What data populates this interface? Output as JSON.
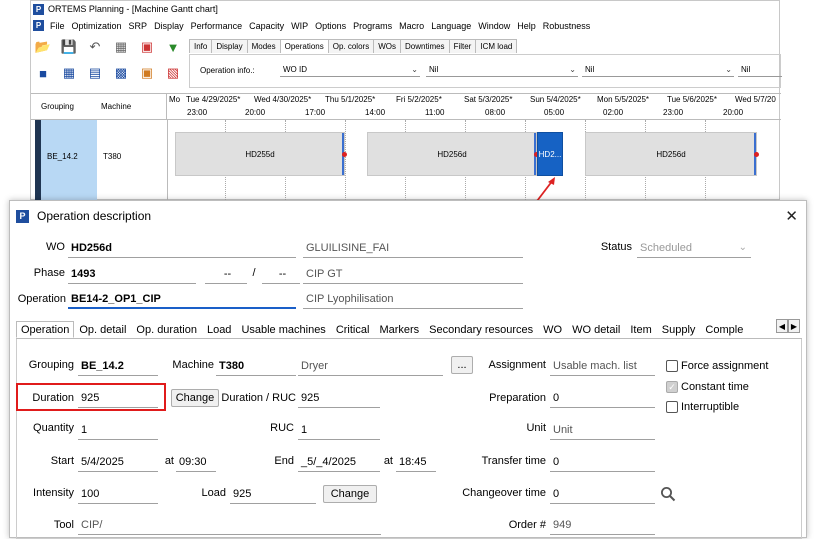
{
  "planning": {
    "title": "ORTEMS  Planning - [Machine Gantt chart]",
    "menu": [
      "File",
      "Optimization",
      "SRP",
      "Display",
      "Performance",
      "Capacity",
      "WIP",
      "Options",
      "Programs",
      "Macro",
      "Language",
      "Window",
      "Help",
      "Robustness"
    ],
    "tabs": [
      "Info",
      "Display",
      "Modes",
      "Operations",
      "Op. colors",
      "WOs",
      "Downtimes",
      "Filter",
      "ICM load"
    ],
    "opinfo_label": "Operation info.:",
    "opinfo_selects": [
      "WO ID",
      "Nil",
      "Nil",
      "Nil"
    ],
    "grid_headers": {
      "grouping": "Grouping",
      "machine": "Machine"
    },
    "days": [
      "Mo",
      "Tue 4/29/2025*",
      "Wed 4/30/2025*",
      "Thu 5/1/2025*",
      "Fri 5/2/2025*",
      "Sat 5/3/2025*",
      "Sun 5/4/2025*",
      "Mon 5/5/2025*",
      "Tue 5/6/2025*",
      "Wed 5/7/20"
    ],
    "hours": [
      "23:00",
      "20:00",
      "17:00",
      "14:00",
      "11:00",
      "08:00",
      "05:00",
      "02:00",
      "23:00",
      "20:00"
    ],
    "row": {
      "grouping": "BE_14.2",
      "machine": "T380"
    },
    "bars": [
      "HD255d",
      "HD256d",
      "HD2...",
      "HD256d"
    ]
  },
  "dialog": {
    "title": "Operation description",
    "wo_label": "WO",
    "wo_value": "HD256d",
    "wo_desc": "GLUILISINE_FAI",
    "status_label": "Status",
    "status_value": "Scheduled",
    "phase_label": "Phase",
    "phase_value": "1493",
    "phase_sub1": "--",
    "phase_slash": "/",
    "phase_sub2": "--",
    "phase_desc": "CIP GT",
    "operation_label": "Operation",
    "operation_value": "BE14-2_OP1_CIP",
    "operation_desc": "CIP Lyophilisation",
    "tabs": [
      "Operation",
      "Op. detail",
      "Op. duration",
      "Load",
      "Usable machines",
      "Critical",
      "Markers",
      "Secondary resources",
      "WO",
      "WO detail",
      "Item",
      "Supply",
      "Comple"
    ],
    "grouping_label": "Grouping",
    "grouping_value": "BE_14.2",
    "machine_label": "Machine",
    "machine_value": "T380",
    "machine_desc": "Dryer",
    "ellipsis": "...",
    "assignment_label": "Assignment",
    "assignment_value": "Usable mach. list",
    "force_assignment": "Force assignment",
    "constant_time": "Constant time",
    "interruptible": "Interruptible",
    "duration_label": "Duration",
    "duration_value": "925",
    "change_label": "Change",
    "duration_ruc_label": "Duration / RUC",
    "duration_ruc_value": "925",
    "preparation_label": "Preparation",
    "preparation_value": "0",
    "quantity_label": "Quantity",
    "quantity_value": "1",
    "ruc_label": "RUC",
    "ruc_value": "1",
    "unit_label": "Unit",
    "unit_value": "Unit",
    "start_label": "Start",
    "start_date": "5/4/2025",
    "at_label": "at",
    "start_time": "09:30",
    "end_label": "End",
    "end_date": "_5/_4/2025",
    "end_time": "18:45",
    "transfer_label": "Transfer time",
    "transfer_value": "0",
    "intensity_label": "Intensity",
    "intensity_value": "100",
    "load_label": "Load",
    "load_value": "925",
    "changeover_label": "Changeover time",
    "changeover_value": "0",
    "tool_label": "Tool",
    "tool_value": "CIP/",
    "order_label": "Order #",
    "order_value": "949"
  }
}
